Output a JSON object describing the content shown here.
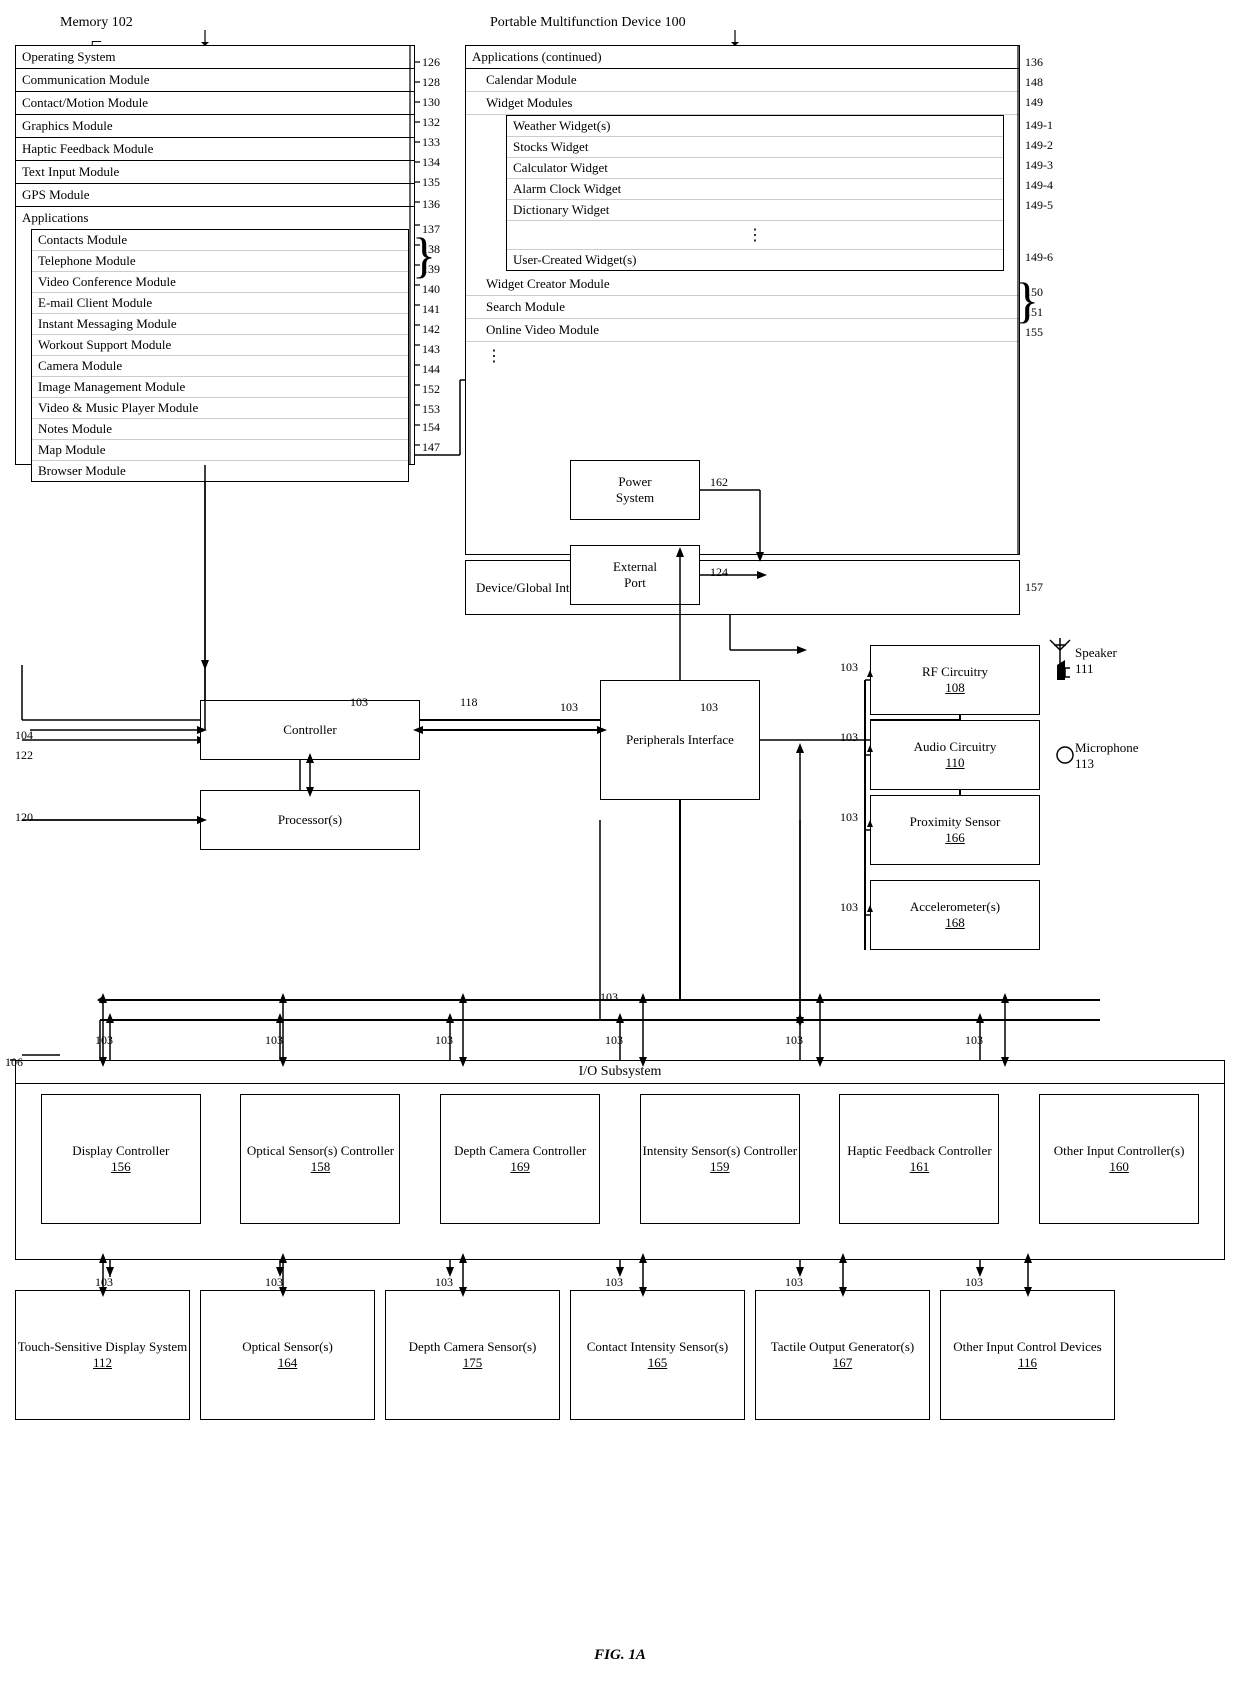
{
  "title": "FIG. 1A",
  "diagram": {
    "memory_label": "Memory 102",
    "portable_label": "Portable Multifunction Device 100",
    "memory_items": [
      {
        "text": "Operating System",
        "ref": "126"
      },
      {
        "text": "Communication Module",
        "ref": "128"
      },
      {
        "text": "Contact/Motion Module",
        "ref": "130"
      },
      {
        "text": "Graphics Module",
        "ref": "132"
      },
      {
        "text": "Haptic Feedback Module",
        "ref": "133"
      },
      {
        "text": "Text Input Module",
        "ref": "134"
      },
      {
        "text": "GPS Module",
        "ref": "135"
      },
      {
        "text": "Applications",
        "ref": "136"
      },
      {
        "text": "Contacts Module",
        "ref": "137",
        "indent": true
      },
      {
        "text": "Telephone Module",
        "ref": "138",
        "indent": true
      },
      {
        "text": "Video Conference Module",
        "ref": "139",
        "indent": true
      },
      {
        "text": "E-mail Client Module",
        "ref": "140",
        "indent": true
      },
      {
        "text": "Instant Messaging Module",
        "ref": "141",
        "indent": true
      },
      {
        "text": "Workout Support Module",
        "ref": "142",
        "indent": true
      },
      {
        "text": "Camera Module",
        "ref": "143",
        "indent": true
      },
      {
        "text": "Image Management Module",
        "ref": "144",
        "indent": true
      },
      {
        "text": "Video & Music Player Module",
        "ref": "152",
        "indent": true
      },
      {
        "text": "Notes Module",
        "ref": "153",
        "indent": true
      },
      {
        "text": "Map Module",
        "ref": "154",
        "indent": true
      },
      {
        "text": "Browser Module",
        "ref": "147",
        "indent": true
      }
    ],
    "portable_items": [
      {
        "text": "Applications (continued)",
        "ref": "136"
      },
      {
        "text": "Calendar Module",
        "ref": "148",
        "indent": true
      },
      {
        "text": "Widget Modules",
        "ref": "149",
        "indent": true
      },
      {
        "text": "Weather Widget(s)",
        "ref": "149-1",
        "indent2": true
      },
      {
        "text": "Stocks Widget",
        "ref": "149-2",
        "indent2": true
      },
      {
        "text": "Calculator Widget",
        "ref": "149-3",
        "indent2": true
      },
      {
        "text": "Alarm Clock Widget",
        "ref": "149-4",
        "indent2": true
      },
      {
        "text": "Dictionary Widget",
        "ref": "149-5",
        "indent2": true
      },
      {
        "text": "User-Created Widget(s)",
        "ref": "149-6",
        "indent2": true
      },
      {
        "text": "Widget Creator Module",
        "ref": "150",
        "indent": true
      },
      {
        "text": "Search Module",
        "ref": "151",
        "indent": true
      },
      {
        "text": "Online Video Module",
        "ref": "155",
        "indent": true
      }
    ],
    "device_state": "Device/Global Internal State",
    "device_state_ref": "157",
    "power_system": "Power System",
    "power_ref": "162",
    "external_port": "External Port",
    "external_ref": "124",
    "rf_circuitry": "RF Circuitry",
    "rf_ref": "108",
    "speaker": "Speaker",
    "speaker_ref": "111",
    "audio_circuitry": "Audio Circuitry",
    "audio_ref": "110",
    "microphone": "Microphone",
    "microphone_ref": "113",
    "proximity_sensor": "Proximity Sensor",
    "proximity_ref": "166",
    "accelerometers": "Accelerometer(s)",
    "accel_ref": "168",
    "controller": "Controller",
    "controller_ref": "104",
    "processor": "Processor(s)",
    "processor_ref": "120",
    "peripherals": "Peripherals Interface",
    "peripherals_ref": "118",
    "io_subsystem": "I/O Subsystem",
    "io_ref": "106",
    "controllers": [
      {
        "name": "Display Controller 156",
        "ref": "156"
      },
      {
        "name": "Optical Sensor(s) Controller 158",
        "ref": "158"
      },
      {
        "name": "Depth Camera Controller 169",
        "ref": "169"
      },
      {
        "name": "Intensity Sensor(s) Controller 159",
        "ref": "159"
      },
      {
        "name": "Haptic Feedback Controller 161",
        "ref": "161"
      },
      {
        "name": "Other Input Controller(s) 160",
        "ref": "160"
      }
    ],
    "sensors": [
      {
        "name": "Touch-Sensitive Display System 112",
        "ref": "112"
      },
      {
        "name": "Optical Sensor(s) 164",
        "ref": "164"
      },
      {
        "name": "Depth Camera Sensor(s) 175",
        "ref": "175"
      },
      {
        "name": "Contact Intensity Sensor(s) 165",
        "ref": "165"
      },
      {
        "name": "Tactile Output Generator(s) 167",
        "ref": "167"
      },
      {
        "name": "Other Input Control Devices 116",
        "ref": "116"
      }
    ],
    "bus_ref": "103",
    "controller_arrow_ref_122": "122",
    "processor_arrow_ref": "120"
  }
}
